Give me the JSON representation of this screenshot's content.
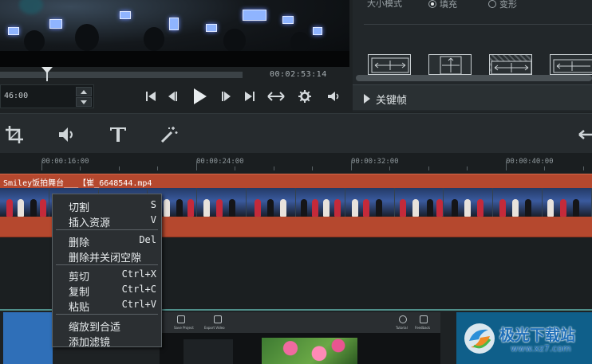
{
  "player": {
    "total_time": "00:02:53:14",
    "current_time": "46:00"
  },
  "properties": {
    "size_mode_label": "大小模式",
    "fill_label": "填充",
    "stretch_label": "变形",
    "keyframe_label": "关键帧"
  },
  "ruler": {
    "ticks": [
      "00:00:16:00",
      "00:00:24:00",
      "00:00:32:00",
      "00:00:40:00"
    ]
  },
  "clip": {
    "title": "Smiley饭拍舞台___【崔_6648544.mp4"
  },
  "context_menu": {
    "cut_split": {
      "label": "切割",
      "shortcut": "S"
    },
    "insert_resource": {
      "label": "插入资源",
      "shortcut": "V"
    },
    "delete": {
      "label": "删除",
      "shortcut": "Del"
    },
    "delete_close_gap": {
      "label": "删除并关闭空隙",
      "shortcut": ""
    },
    "cut": {
      "label": "剪切",
      "shortcut": "Ctrl+X"
    },
    "copy": {
      "label": "复制",
      "shortcut": "Ctrl+C"
    },
    "paste": {
      "label": "粘贴",
      "shortcut": "Ctrl+V"
    },
    "zoom_fit": {
      "label": "缩放到合适",
      "shortcut": ""
    },
    "add_filter": {
      "label": "添加滤镜",
      "shortcut": ""
    }
  },
  "bottom_preview": {
    "save_project": "Save Project",
    "export_video": "Export Video",
    "tutorial": "Tutorial",
    "feedback": "Feedback"
  },
  "watermark": {
    "name": "极光下载站",
    "url": "www.xz7.com"
  },
  "colors": {
    "clip": "#b5482e",
    "background": "#1e2224",
    "menu": "#2b2f32",
    "watermark": "#1f6fb9"
  }
}
